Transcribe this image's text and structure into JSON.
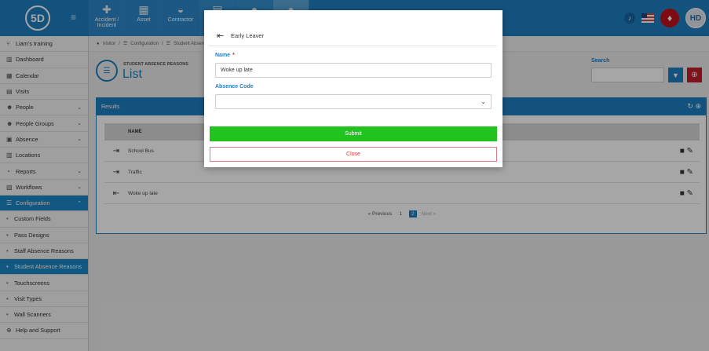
{
  "header": {
    "logo_text": "5D",
    "tabs": [
      {
        "label": "Accident / Incident",
        "icon": "first-aid-kit-icon"
      },
      {
        "label": "Asset",
        "icon": "boxes-icon"
      },
      {
        "label": "Contractor",
        "icon": "hardhat-icon"
      },
      {
        "label": "",
        "icon": "document-icon"
      },
      {
        "label": "",
        "icon": "person-icon"
      },
      {
        "label": "",
        "icon": "hat-icon"
      }
    ],
    "avatar_initials": "HD"
  },
  "sidebar": {
    "items": [
      {
        "label": "Liam's training",
        "icon": "switch-icon",
        "chevron": false
      },
      {
        "label": "Dashboard",
        "icon": "dashboard-icon",
        "chevron": false
      },
      {
        "label": "Calendar",
        "icon": "calendar-icon",
        "chevron": false
      },
      {
        "label": "Visits",
        "icon": "visits-icon",
        "chevron": false
      },
      {
        "label": "People",
        "icon": "people-icon",
        "chevron": true
      },
      {
        "label": "People Groups",
        "icon": "people-groups-icon",
        "chevron": true
      },
      {
        "label": "Absence",
        "icon": "absence-icon",
        "chevron": true
      },
      {
        "label": "Locations",
        "icon": "locations-icon",
        "chevron": false
      },
      {
        "label": "Reports",
        "icon": "reports-icon",
        "chevron": true
      },
      {
        "label": "Workflows",
        "icon": "workflows-icon",
        "chevron": true
      },
      {
        "label": "Configuration",
        "icon": "configuration-icon",
        "chevron": true
      }
    ],
    "config_sub": [
      "Custom Fields",
      "Pass Designs",
      "Staff Absence Reasons",
      "Student Absence Reasons",
      "Touchscreens",
      "Visit Types",
      "Wall Scanners"
    ],
    "help": "Help and Support"
  },
  "breadcrumb": {
    "items": [
      "Visitor",
      "Configuration",
      "Student Absen"
    ]
  },
  "page": {
    "subtitle": "STUDENT ABSENCE REASONS",
    "title": "List"
  },
  "search": {
    "label": "Search"
  },
  "results": {
    "title": "Results",
    "column_name": "NAME",
    "rows": [
      {
        "name": "School Bus",
        "icon": "sign-in-icon"
      },
      {
        "name": "Traffic",
        "icon": "sign-in-icon"
      },
      {
        "name": "Woke up late",
        "icon": "sign-out-icon"
      }
    ],
    "pager": {
      "previous": "Previous",
      "pages": [
        "1",
        "2"
      ],
      "current": "2",
      "next": "Next"
    }
  },
  "modal": {
    "title": "Early Leaver",
    "name_label": "Name",
    "required_mark": "*",
    "name_value": "Woke up late",
    "absence_code_label": "Absence Code",
    "absence_code_value": "",
    "submit_label": "Submit",
    "close_label": "Close"
  }
}
